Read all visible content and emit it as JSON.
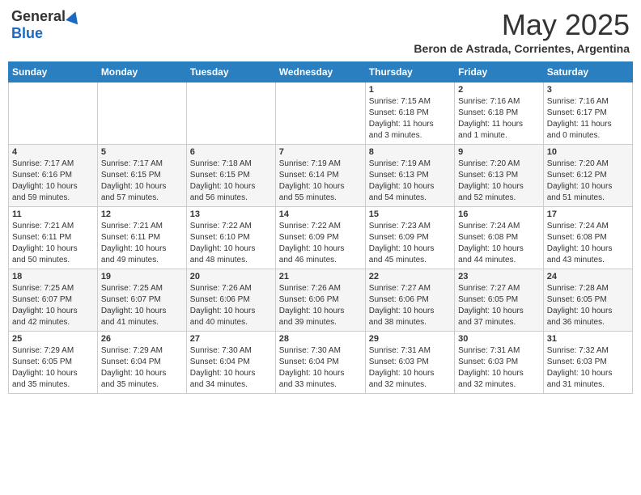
{
  "logo": {
    "general": "General",
    "blue": "Blue"
  },
  "header": {
    "month": "May 2025",
    "location": "Beron de Astrada, Corrientes, Argentina"
  },
  "weekdays": [
    "Sunday",
    "Monday",
    "Tuesday",
    "Wednesday",
    "Thursday",
    "Friday",
    "Saturday"
  ],
  "weeks": [
    [
      {
        "day": "",
        "info": ""
      },
      {
        "day": "",
        "info": ""
      },
      {
        "day": "",
        "info": ""
      },
      {
        "day": "",
        "info": ""
      },
      {
        "day": "1",
        "info": "Sunrise: 7:15 AM\nSunset: 6:18 PM\nDaylight: 11 hours\nand 3 minutes."
      },
      {
        "day": "2",
        "info": "Sunrise: 7:16 AM\nSunset: 6:18 PM\nDaylight: 11 hours\nand 1 minute."
      },
      {
        "day": "3",
        "info": "Sunrise: 7:16 AM\nSunset: 6:17 PM\nDaylight: 11 hours\nand 0 minutes."
      }
    ],
    [
      {
        "day": "4",
        "info": "Sunrise: 7:17 AM\nSunset: 6:16 PM\nDaylight: 10 hours\nand 59 minutes."
      },
      {
        "day": "5",
        "info": "Sunrise: 7:17 AM\nSunset: 6:15 PM\nDaylight: 10 hours\nand 57 minutes."
      },
      {
        "day": "6",
        "info": "Sunrise: 7:18 AM\nSunset: 6:15 PM\nDaylight: 10 hours\nand 56 minutes."
      },
      {
        "day": "7",
        "info": "Sunrise: 7:19 AM\nSunset: 6:14 PM\nDaylight: 10 hours\nand 55 minutes."
      },
      {
        "day": "8",
        "info": "Sunrise: 7:19 AM\nSunset: 6:13 PM\nDaylight: 10 hours\nand 54 minutes."
      },
      {
        "day": "9",
        "info": "Sunrise: 7:20 AM\nSunset: 6:13 PM\nDaylight: 10 hours\nand 52 minutes."
      },
      {
        "day": "10",
        "info": "Sunrise: 7:20 AM\nSunset: 6:12 PM\nDaylight: 10 hours\nand 51 minutes."
      }
    ],
    [
      {
        "day": "11",
        "info": "Sunrise: 7:21 AM\nSunset: 6:11 PM\nDaylight: 10 hours\nand 50 minutes."
      },
      {
        "day": "12",
        "info": "Sunrise: 7:21 AM\nSunset: 6:11 PM\nDaylight: 10 hours\nand 49 minutes."
      },
      {
        "day": "13",
        "info": "Sunrise: 7:22 AM\nSunset: 6:10 PM\nDaylight: 10 hours\nand 48 minutes."
      },
      {
        "day": "14",
        "info": "Sunrise: 7:22 AM\nSunset: 6:09 PM\nDaylight: 10 hours\nand 46 minutes."
      },
      {
        "day": "15",
        "info": "Sunrise: 7:23 AM\nSunset: 6:09 PM\nDaylight: 10 hours\nand 45 minutes."
      },
      {
        "day": "16",
        "info": "Sunrise: 7:24 AM\nSunset: 6:08 PM\nDaylight: 10 hours\nand 44 minutes."
      },
      {
        "day": "17",
        "info": "Sunrise: 7:24 AM\nSunset: 6:08 PM\nDaylight: 10 hours\nand 43 minutes."
      }
    ],
    [
      {
        "day": "18",
        "info": "Sunrise: 7:25 AM\nSunset: 6:07 PM\nDaylight: 10 hours\nand 42 minutes."
      },
      {
        "day": "19",
        "info": "Sunrise: 7:25 AM\nSunset: 6:07 PM\nDaylight: 10 hours\nand 41 minutes."
      },
      {
        "day": "20",
        "info": "Sunrise: 7:26 AM\nSunset: 6:06 PM\nDaylight: 10 hours\nand 40 minutes."
      },
      {
        "day": "21",
        "info": "Sunrise: 7:26 AM\nSunset: 6:06 PM\nDaylight: 10 hours\nand 39 minutes."
      },
      {
        "day": "22",
        "info": "Sunrise: 7:27 AM\nSunset: 6:06 PM\nDaylight: 10 hours\nand 38 minutes."
      },
      {
        "day": "23",
        "info": "Sunrise: 7:27 AM\nSunset: 6:05 PM\nDaylight: 10 hours\nand 37 minutes."
      },
      {
        "day": "24",
        "info": "Sunrise: 7:28 AM\nSunset: 6:05 PM\nDaylight: 10 hours\nand 36 minutes."
      }
    ],
    [
      {
        "day": "25",
        "info": "Sunrise: 7:29 AM\nSunset: 6:05 PM\nDaylight: 10 hours\nand 35 minutes."
      },
      {
        "day": "26",
        "info": "Sunrise: 7:29 AM\nSunset: 6:04 PM\nDaylight: 10 hours\nand 35 minutes."
      },
      {
        "day": "27",
        "info": "Sunrise: 7:30 AM\nSunset: 6:04 PM\nDaylight: 10 hours\nand 34 minutes."
      },
      {
        "day": "28",
        "info": "Sunrise: 7:30 AM\nSunset: 6:04 PM\nDaylight: 10 hours\nand 33 minutes."
      },
      {
        "day": "29",
        "info": "Sunrise: 7:31 AM\nSunset: 6:03 PM\nDaylight: 10 hours\nand 32 minutes."
      },
      {
        "day": "30",
        "info": "Sunrise: 7:31 AM\nSunset: 6:03 PM\nDaylight: 10 hours\nand 32 minutes."
      },
      {
        "day": "31",
        "info": "Sunrise: 7:32 AM\nSunset: 6:03 PM\nDaylight: 10 hours\nand 31 minutes."
      }
    ]
  ]
}
